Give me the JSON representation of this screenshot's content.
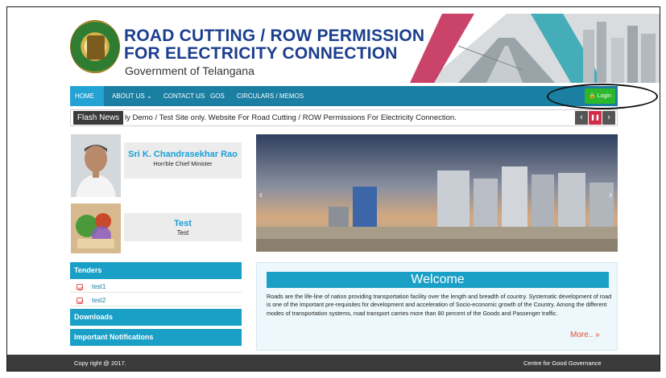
{
  "header": {
    "title_line1": "ROAD CUTTING / ROW PERMISSION",
    "title_line2": "FOR ELECTRICITY CONNECTION",
    "subtitle": "Government of Telangana"
  },
  "nav": {
    "items": [
      {
        "label": "HOME"
      },
      {
        "label": "ABOUT US ⌄"
      },
      {
        "label": "CONTACT US"
      },
      {
        "label": "GOS"
      },
      {
        "label": "CIRCULARS / MEMOS"
      }
    ],
    "login_label": "🔒 Login"
  },
  "flash": {
    "label": "Flash News",
    "text": "ly Demo / Test Site only.  Website For Road Cutting / ROW Permissions For Electricity Connection.",
    "controls": {
      "prev": "‹",
      "pause": "❚❚",
      "next": "›"
    }
  },
  "profiles": [
    {
      "name": "Sri K. Chandrasekhar Rao",
      "role": "Hon'ble Chief Minister"
    },
    {
      "name": "Test",
      "role": "Test"
    }
  ],
  "sidebar": {
    "tenders_label": "Tenders",
    "tenders": [
      {
        "label": "test1"
      },
      {
        "label": "test2"
      }
    ],
    "downloads_label": "Downloads",
    "notifications_label": "Important Notifications"
  },
  "slider": {
    "prev": "‹",
    "next": "›"
  },
  "welcome": {
    "title": "Welcome",
    "body": "Roads are the life-line of nation providing transportation facility over the length and breadth of country. Systematic development of road is one of the important pre-requisites for development and acceleration of Socio-economic growth of the Country. Among the different modes of transportation systems, road transport carries more than 80 percent of the Goods and Passenger traffic.",
    "more_label": "More.. »"
  },
  "footer": {
    "copyright": "Copy right @ 2017.",
    "credit": "Centre for Good Governance"
  },
  "colors": {
    "nav": "#1a7fa3",
    "accent": "#1aa0c7",
    "title": "#1b3f8e",
    "login": "#2cb82c",
    "footer": "#3b3b3b"
  }
}
